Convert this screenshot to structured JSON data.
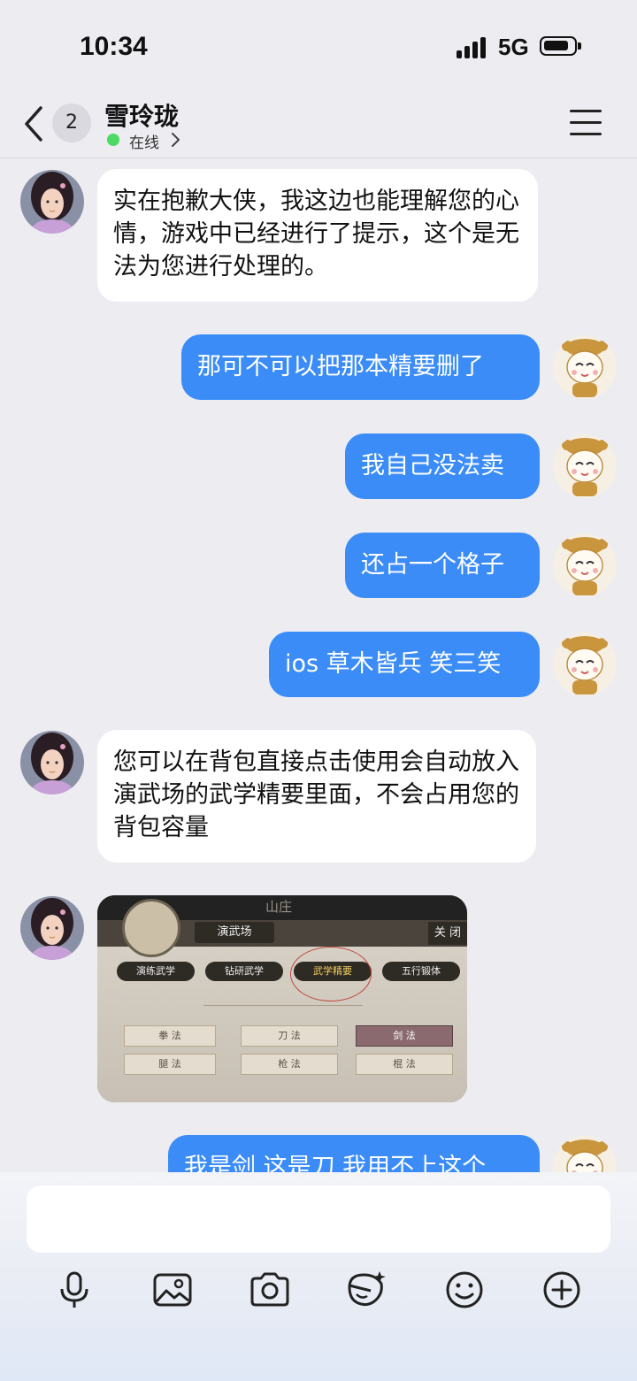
{
  "status_bar": {
    "time": "10:34",
    "network": "5G"
  },
  "header": {
    "back_badge": "2",
    "contact_name": "雪玲珑",
    "status": "在线"
  },
  "messages": [
    {
      "side": "in",
      "type": "text",
      "text": "实在抱歉大侠，我这边也能理解您的心情，游戏中已经进行了提示，这个是无法为您进行处理的。"
    },
    {
      "side": "out",
      "type": "text",
      "text": "那可不可以把那本精要删了"
    },
    {
      "side": "out",
      "type": "text",
      "text": "我自己没法卖"
    },
    {
      "side": "out",
      "type": "text",
      "text": "还占一个格子"
    },
    {
      "side": "out",
      "type": "text",
      "text": "ios 草木皆兵 笑三笑"
    },
    {
      "side": "in",
      "type": "text",
      "text": "您可以在背包直接点击使用会自动放入演武场的武学精要里面，不会占用您的背包容量"
    },
    {
      "side": "in",
      "type": "image",
      "game_screen": {
        "top_label": "山庄",
        "panel_title": "演武场",
        "close_label": "关 闭",
        "tabs": [
          "演练武学",
          "钻研武学",
          "武学精要",
          "五行锻体"
        ],
        "selected_tab": "武学精要",
        "categories": [
          "拳 法",
          "刀 法",
          "剑 法",
          "腿 法",
          "枪 法",
          "棍 法"
        ]
      }
    },
    {
      "side": "out",
      "type": "text",
      "text": "我是剑 这是刀 我用不上这个"
    }
  ],
  "composer": {
    "input_value": "",
    "tools": [
      "microphone-icon",
      "image-icon",
      "camera-icon",
      "sticker-icon",
      "emoji-icon",
      "plus-icon"
    ]
  },
  "colors": {
    "outgoing_bubble": "#3b8cf7",
    "incoming_bubble": "#ffffff",
    "background": "#ececf1",
    "online": "#4cd964"
  }
}
